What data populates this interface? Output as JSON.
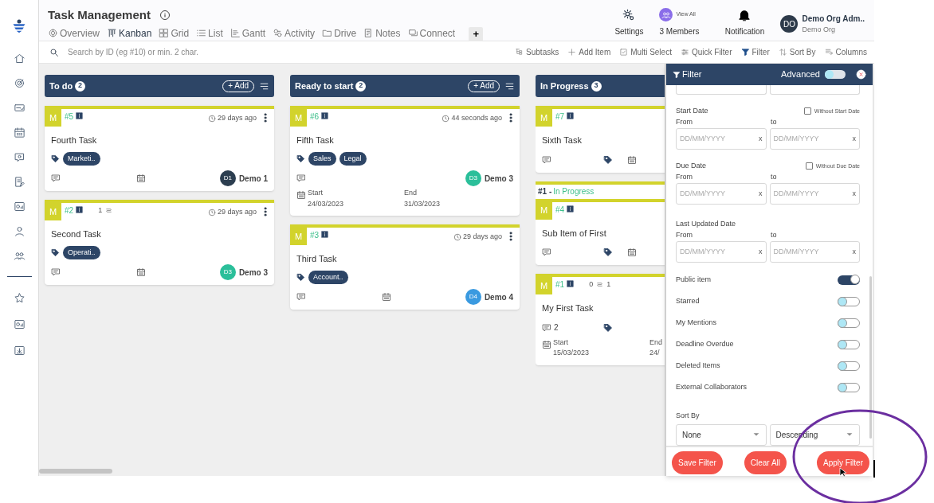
{
  "app": {
    "title": "Task Management"
  },
  "tabs": [
    {
      "label": "Overview",
      "selected": false
    },
    {
      "label": "Kanban",
      "selected": true
    },
    {
      "label": "Grid",
      "selected": false
    },
    {
      "label": "List",
      "selected": false
    },
    {
      "label": "Gantt",
      "selected": false
    },
    {
      "label": "Activity",
      "selected": false
    },
    {
      "label": "Drive",
      "selected": false
    },
    {
      "label": "Notes",
      "selected": false
    },
    {
      "label": "Connect",
      "selected": false
    }
  ],
  "add_tab": "+",
  "header_actions": {
    "settings": "Settings",
    "members": {
      "view_all": "View All",
      "label": "3 Members"
    },
    "notification": "Notification",
    "user": {
      "initials": "DO",
      "name": "Demo Org Adm..",
      "org": "Demo Org"
    }
  },
  "search": {
    "placeholder": "Search by ID (eg #10) or min. 2 char."
  },
  "toolbar": [
    {
      "label": "Subtasks",
      "active": false
    },
    {
      "label": "Add Item",
      "active": false
    },
    {
      "label": "Multi Select",
      "active": false
    },
    {
      "label": "Quick Filter",
      "active": false
    },
    {
      "label": "Filter",
      "active": true
    },
    {
      "label": "Sort By",
      "active": false
    },
    {
      "label": "Columns",
      "active": false
    }
  ],
  "columns": [
    {
      "title": "To do",
      "count": "2",
      "add_label": "+ Add",
      "items": [
        {
          "kind": "card",
          "badge": "M",
          "id": "#5",
          "time": "29 days ago",
          "title": "Fourth Task",
          "tags": [
            "Marketi.."
          ],
          "assignee": {
            "initials": "D1",
            "name": "Demo 1",
            "color": "#2c3e50"
          }
        },
        {
          "kind": "card",
          "badge": "M",
          "id": "#2",
          "subtasks": [
            "1"
          ],
          "time": "29 days ago",
          "title": "Second Task",
          "tags": [
            "Operati.."
          ],
          "assignee": {
            "initials": "D3",
            "name": "Demo 3",
            "color": "#2bbf9a"
          }
        }
      ]
    },
    {
      "title": "Ready to start",
      "count": "2",
      "add_label": "+ Add",
      "items": [
        {
          "kind": "card",
          "badge": "M",
          "id": "#6",
          "time": "44 seconds ago",
          "title": "Fifth Task",
          "tags": [
            "Sales",
            "Legal"
          ],
          "assignee": {
            "initials": "D3",
            "name": "Demo 3",
            "color": "#2bbf9a"
          },
          "start": {
            "label": "Start",
            "date": "24/03/2023"
          },
          "end": {
            "label": "End",
            "date": "31/03/2023"
          }
        },
        {
          "kind": "card",
          "badge": "M",
          "id": "#3",
          "time": "29 days ago",
          "title": "Third Task",
          "tags": [
            "Account.."
          ],
          "assignee": {
            "initials": "D4",
            "name": "Demo 4",
            "color": "#3a9ae0"
          }
        }
      ]
    },
    {
      "title": "In Progress",
      "count": "3",
      "items": [
        {
          "kind": "card",
          "badge": "M",
          "id": "#7",
          "title": "Sixth Task",
          "footer_tag": true
        },
        {
          "kind": "group",
          "number": "#1 -",
          "status": "In Progress"
        },
        {
          "kind": "card",
          "badge": "M",
          "id": "#4",
          "title": "Sub Item of First",
          "footer_tag": true
        },
        {
          "kind": "card",
          "badge": "M",
          "id": "#1",
          "subtasks": [
            "0",
            "1"
          ],
          "title": "My First Task",
          "comments": "2",
          "footer_tag": true,
          "start": {
            "label": "Start",
            "date": "15/03/2023"
          },
          "end": {
            "label": "End",
            "date": "24/"
          }
        }
      ]
    }
  ],
  "filter": {
    "title": "Filter",
    "advanced": {
      "label": "Advanced",
      "on": false
    },
    "date_filters": [
      {
        "label": "Start Date",
        "checkbox": {
          "label": "Without Start Date",
          "checked": false
        },
        "from_label": "From",
        "to_label": "to",
        "inputs": [
          {
            "placeholder": "DD/MM/YYYY",
            "clear": "x"
          },
          {
            "placeholder": "DD/MM/YYYY",
            "clear": "x"
          }
        ]
      },
      {
        "label": "Due Date",
        "checkbox": {
          "label": "Without Due Date",
          "checked": false
        },
        "from_label": "From",
        "to_label": "to",
        "inputs": [
          {
            "placeholder": "DD/MM/YYYY",
            "clear": "x"
          },
          {
            "placeholder": "DD/MM/YYYY",
            "clear": "x"
          }
        ]
      },
      {
        "label": "Last Updated Date",
        "from_label": "From",
        "to_label": "to",
        "inputs": [
          {
            "placeholder": "DD/MM/YYYY",
            "clear": "x"
          },
          {
            "placeholder": "DD/MM/YYYY",
            "clear": "x"
          }
        ]
      }
    ],
    "toggles": [
      {
        "label": "Public item",
        "on": true
      },
      {
        "label": "Starred",
        "on": false
      },
      {
        "label": "My Mentions",
        "on": false
      },
      {
        "label": "Deadline Overdue",
        "on": false
      },
      {
        "label": "Deleted Items",
        "on": false
      },
      {
        "label": "External Collaborators",
        "on": false
      }
    ],
    "sort": {
      "label": "Sort By",
      "selects": [
        "None",
        "Descending"
      ]
    },
    "buttons": [
      "Save Filter",
      "Clear All",
      "Apply Filter"
    ]
  }
}
